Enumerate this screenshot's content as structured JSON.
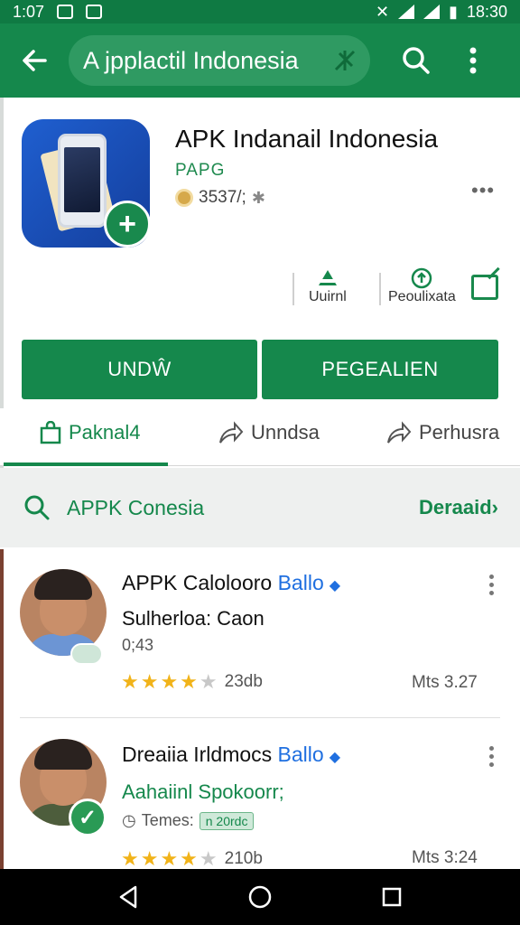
{
  "status_bar": {
    "time_left": "1:07",
    "time_right": "18:30"
  },
  "app_bar": {
    "search_text": "A jpplactil Indonesia"
  },
  "app": {
    "title": "APK Indanail Indonesia",
    "developer": "PAPG",
    "rating_text": "3537/;",
    "actions": [
      {
        "label": "Uuirnl"
      },
      {
        "label": "Peoulixata"
      }
    ],
    "buttons": {
      "primary": "UNDŴ",
      "secondary": "PEGEALIEN"
    }
  },
  "tabs": [
    {
      "label": "Paknal4",
      "active": true
    },
    {
      "label": "Unndsa",
      "active": false
    },
    {
      "label": "Perhusra",
      "active": false
    }
  ],
  "search_row": {
    "label": "APPK Conesia",
    "more": "Deraaid›"
  },
  "reviews": [
    {
      "name": "APPK Calolooro",
      "tag": "Ballo",
      "subtitle": "Sulherloa: Caon",
      "meta": "0;43",
      "stars": 4,
      "count": "23db",
      "date": "Mts 3.27"
    },
    {
      "name": "Dreaiia Irldmocs",
      "tag": "Ballo",
      "subtitle": "Aahaiinl Spokoorr;",
      "meta": "Temes:",
      "chip": "n 20rdc",
      "stars": 4,
      "count": "210b",
      "date": "Mts 3:24"
    }
  ],
  "colors": {
    "primary": "#15884c",
    "status": "#0f7a43",
    "star": "#f1b319",
    "link": "#1f6fe0"
  }
}
